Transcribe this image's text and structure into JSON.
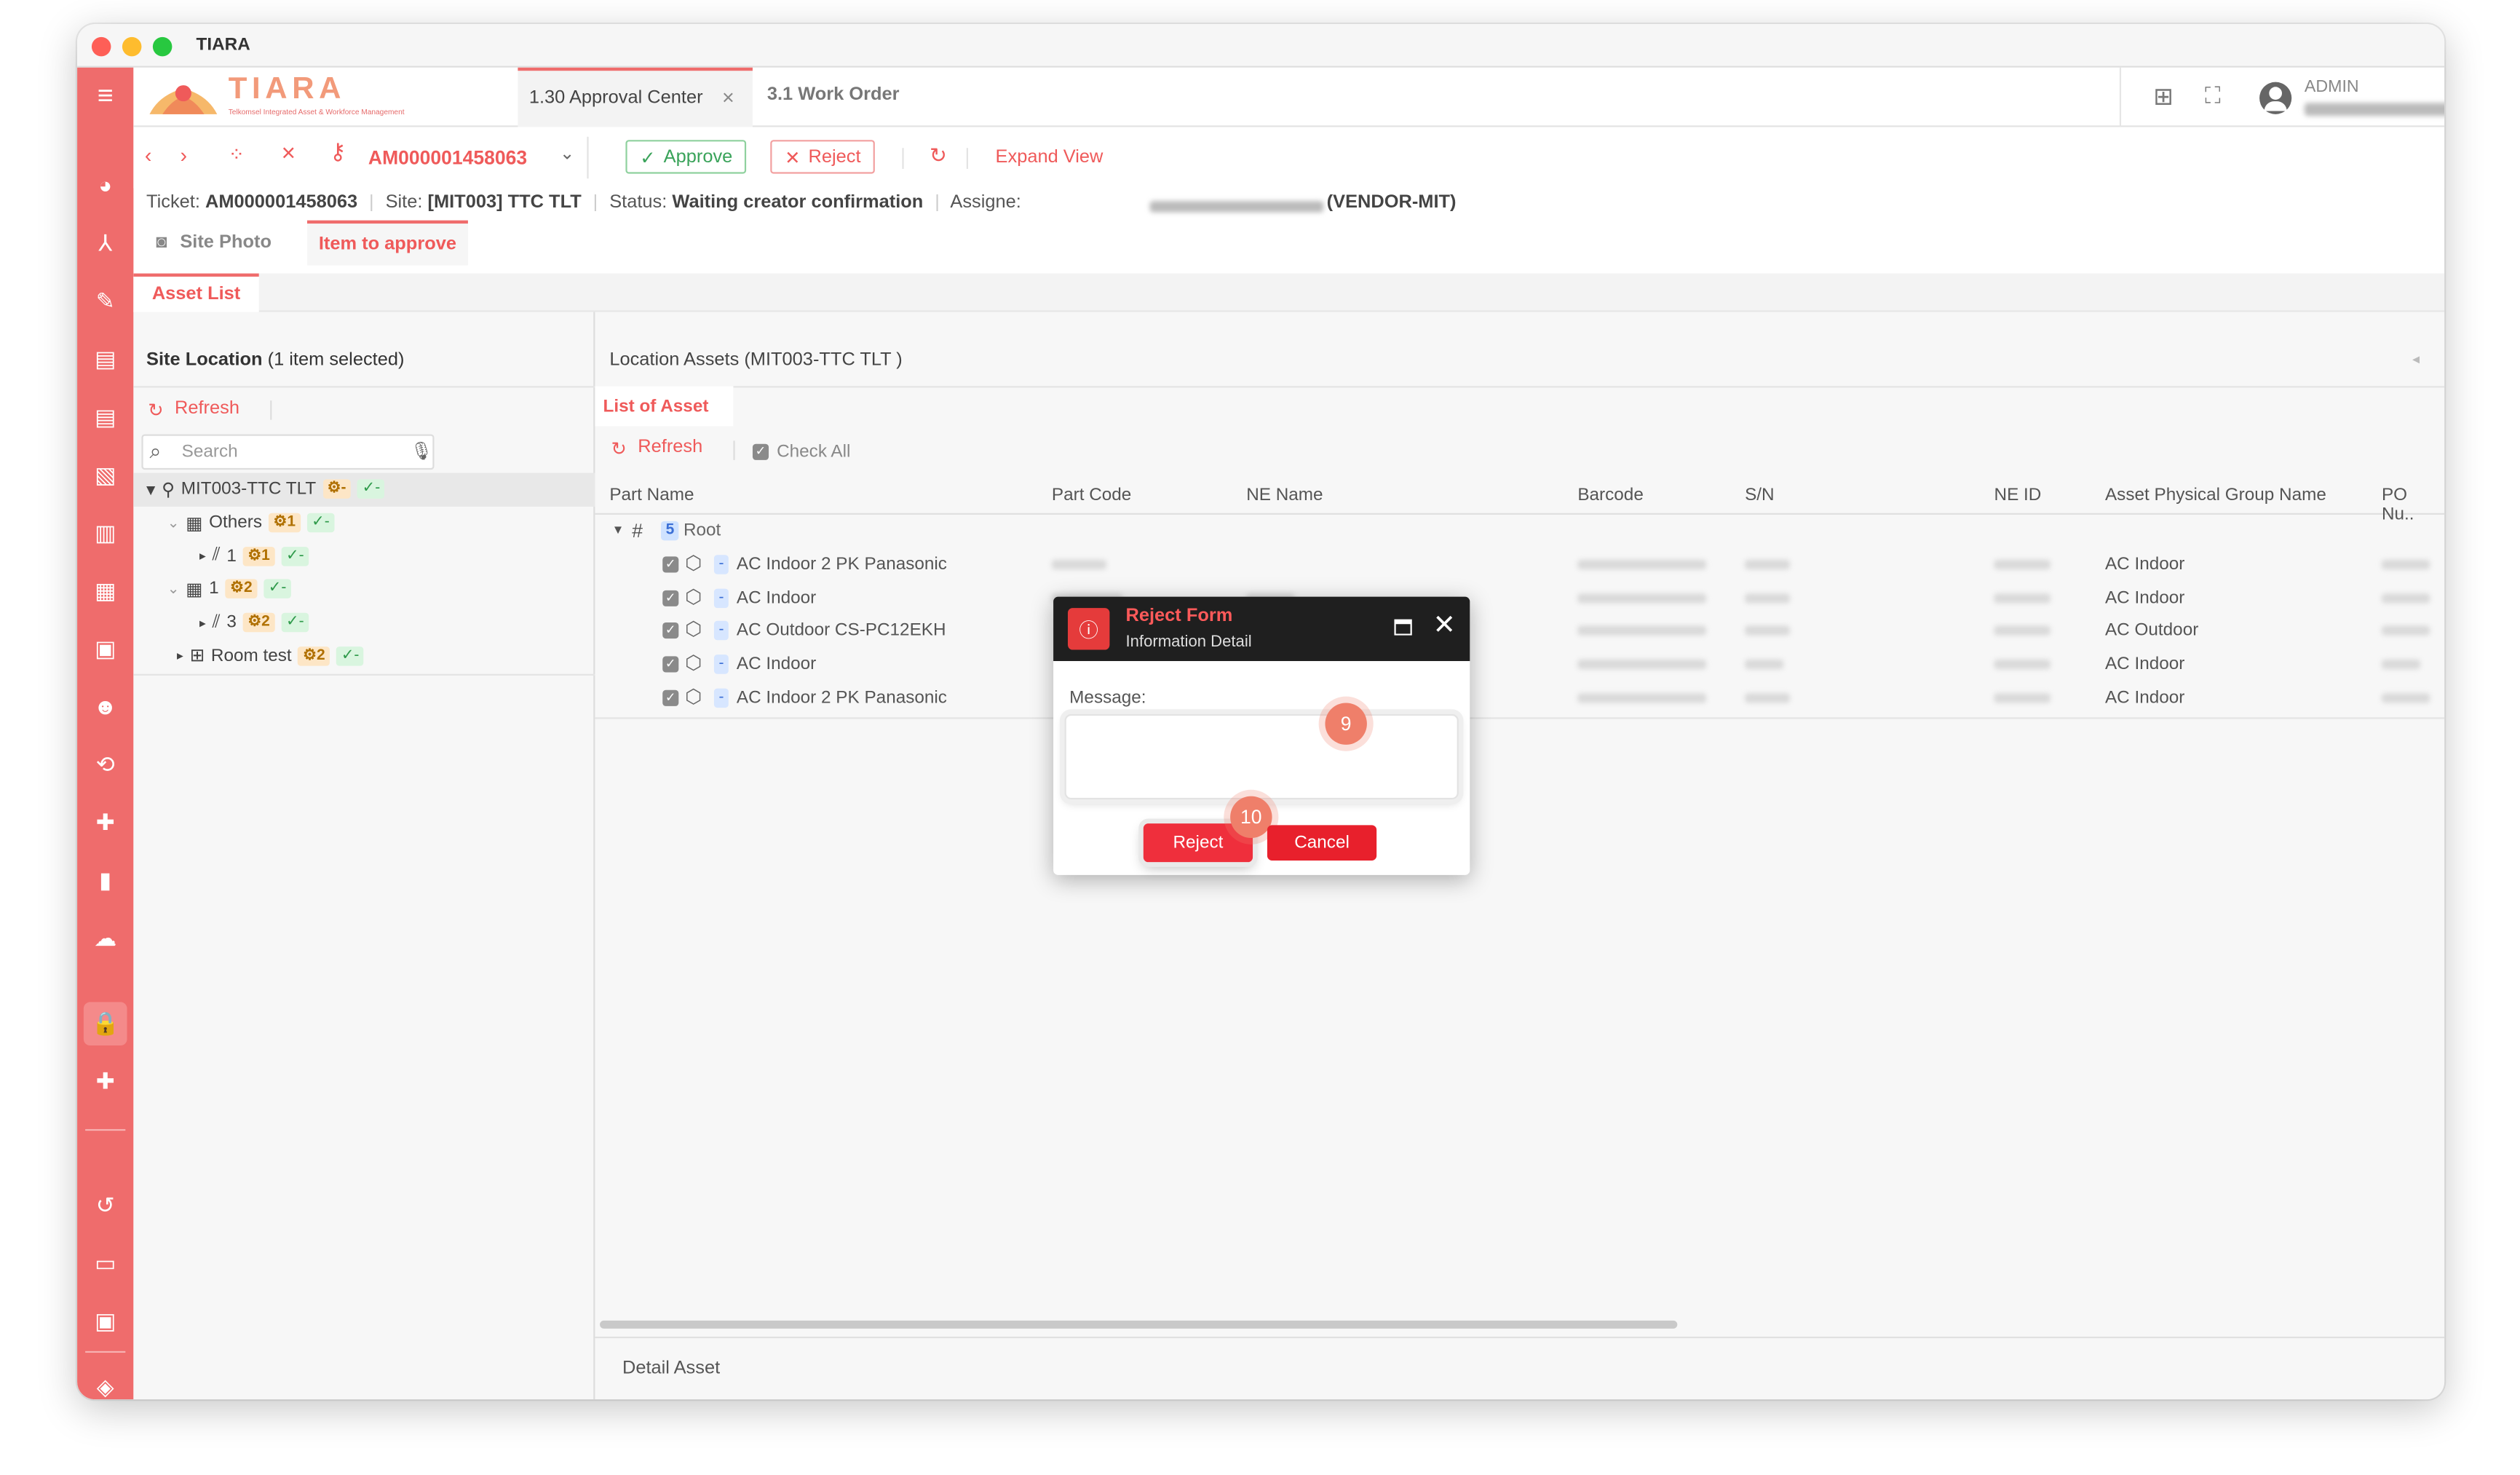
{
  "window": {
    "title": "TIARA"
  },
  "brand": {
    "name": "TIARA",
    "tagline": "Telkomsel Integrated Asset & Workforce Management",
    "accent": "#ef6c6c"
  },
  "tabs": [
    {
      "label": "1.30 Approval Center"
    },
    {
      "label": "3.1 Work Order"
    }
  ],
  "user": {
    "role": "ADMIN"
  },
  "toolbar": {
    "ticket_id": "AM000001458063",
    "approve": "Approve",
    "reject": "Reject",
    "expand": "Expand View"
  },
  "info": {
    "ticket_label": "Ticket:",
    "ticket": "AM000001458063",
    "site_label": "Site:",
    "site": "[MIT003] TTC TLT",
    "status_label": "Status:",
    "status": "Waiting creator confirmation",
    "assignee_label": "Assigne:",
    "assignee_org": "(VENDOR-MIT)"
  },
  "subtabs": {
    "photo": "Site Photo",
    "approve": "Item to approve",
    "asset_list": "Asset List"
  },
  "left": {
    "title": "Site Location",
    "selection": "(1 item selected)",
    "refresh": "Refresh",
    "search_placeholder": "Search",
    "tree": {
      "root": "MIT003-TTC TLT",
      "root_chip1": "-",
      "root_chip2": "-",
      "others": "Others",
      "others_c": "1",
      "others_g": "-",
      "o1": "1",
      "o1_c": "1",
      "o1_g": "-",
      "b1": "1",
      "b1_c": "2",
      "b1_g": "-",
      "b3": "3",
      "b3_c": "2",
      "b3_g": "-",
      "room": "Room test",
      "room_c": "2",
      "room_g": "-"
    }
  },
  "right": {
    "title": "Location Assets (MIT003-TTC TLT )",
    "tab": "List of Asset",
    "refresh": "Refresh",
    "check_all": "Check All",
    "columns": [
      "Part Name",
      "Part Code",
      "NE Name",
      "Barcode",
      "S/N",
      "NE ID",
      "Asset Physical Group Name",
      "PO Nu.."
    ],
    "root_count": "5",
    "root_label": "Root",
    "rows": [
      {
        "name": "AC Indoor 2 PK Panasonic",
        "group": "AC Indoor"
      },
      {
        "name": "AC Indoor",
        "group": "AC Indoor"
      },
      {
        "name": "AC Outdoor CS-PC12EKH",
        "group": "AC Outdoor"
      },
      {
        "name": "AC Indoor",
        "group": "AC Indoor"
      },
      {
        "name": "AC Indoor 2 PK Panasonic",
        "group": "AC Indoor"
      }
    ],
    "chip_dash": "-",
    "detail": "Detail Asset"
  },
  "modal": {
    "title": "Reject Form",
    "subtitle": "Information Detail",
    "message_label": "Message:",
    "reject": "Reject",
    "cancel": "Cancel",
    "step_a": "9",
    "step_b": "10"
  }
}
